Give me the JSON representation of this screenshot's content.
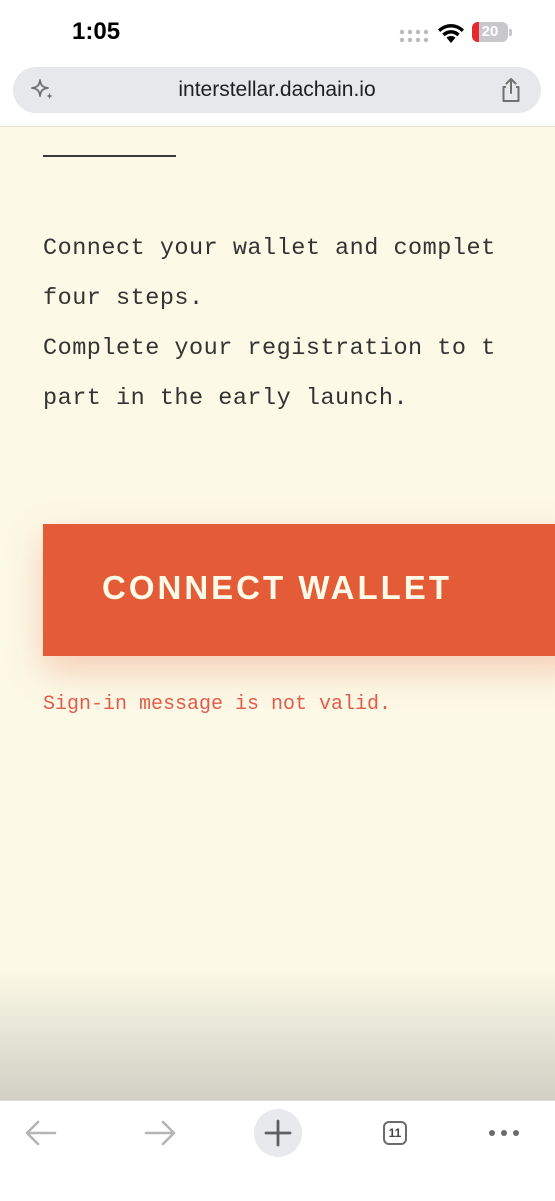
{
  "status_bar": {
    "time": "1:05",
    "battery_level": "20",
    "battery_fraction": 0.2,
    "icons": [
      "cellular-signal-icon",
      "wifi-icon",
      "battery-icon"
    ]
  },
  "browser": {
    "url": "interstellar.dachain.io",
    "icons": [
      "sparkle-icon",
      "share-icon"
    ]
  },
  "page": {
    "intro_lines": [
      "Connect your wallet and complet",
      "four steps.",
      "Complete your registration to t",
      "part in the early launch."
    ],
    "connect_button_label": "CONNECT WALLET",
    "error_message": "Sign-in message is not valid."
  },
  "toolbar": {
    "tab_count": "11",
    "icons": [
      "back-arrow-icon",
      "forward-arrow-icon",
      "plus-icon",
      "tabs-icon",
      "more-icon"
    ]
  },
  "colors": {
    "page_background": "#fcf9e6",
    "accent": "#e35b37",
    "error": "#e35b4a",
    "button_text": "#fffbe8"
  }
}
